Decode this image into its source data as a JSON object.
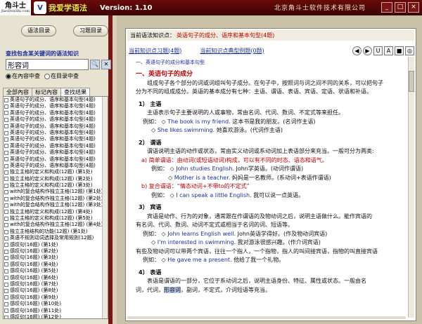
{
  "app": {
    "logo_text": "角斗士",
    "logo_sub": "JiaoDouShi.com",
    "brand_badge": "V",
    "brand_name": "我爱学语法",
    "version": "Version: 1.10",
    "company": "北京角斗士软件技术有限公司",
    "win_min": "_",
    "win_max": "□",
    "win_close": "×"
  },
  "left": {
    "btn_catalog": "语法目录",
    "btn_exercise": "习题目录",
    "search_title": "查找包含某关键词的语法知识",
    "search_value": "形容词",
    "search_btn1": "🔍",
    "search_btn2": "✕",
    "radio_current": "在內容中查",
    "radio_catalog": "在目录中查",
    "tabs": [
      "全部內容",
      "标记內容",
      "查找结果"
    ],
    "items": [
      "英语句子的成分、语序和基本句型(4题)",
      "英语句子的成分、语序和基本句型(4题)",
      "英语句子的成分、语序和基本句型(4题)",
      "英语句子的成分、语序和基本句型(4题)",
      "英语句子的成分、语序和基本句型(4题)",
      "英语句子的成分、语序和基本句型(4题)",
      "英语句子的成分、语序和基本句型(4题)",
      "英语句子的成分、语序和基本句型(4题)",
      "英语句子的成分、语序和基本句型(4题)",
      "英语句子的成分、语序和基本句型(4题)",
      "英语句子的成分、语序和基本句型(4题)",
      "独立主格的定义和构成(12题) (第1处)",
      "独立主格的定义和构成(12题) (第2处)",
      "独立主格的定义和构成(12题) (第3处)",
      "with的复合结构作独立主格(12题) (第1处)",
      "with的复合结构作独立主格(12题) (第2处)",
      "with的复合结构作独立主格(12题) (第3处)",
      "独立主格的定义和构成(12题) (第4处)",
      "独立主格的定义和构成(12题) (第5处)",
      "with的复合结构作独立主格(12题) (第4处)",
      "独立主格结构的功能(12题) (第1处)",
      "英语不规则动词选择及常用规则(12题)",
      "感叹句(16题) (第1处)",
      "感叹句(16题) (第2处)",
      "感叹句(16题) (第3处)",
      "感叹句(16题) (第4处)",
      "感叹句(16题) (第5处)",
      "感叹句(16题) (第6处)",
      "感叹句(16题) (第7处)",
      "感叹句(16题) (第8处)",
      "感叹句(16题) (第9处)",
      "感叹句(16题) (第10处)",
      "感叹句(16题) (第11处)",
      "感叹句(16题) (第12处)"
    ]
  },
  "main": {
    "current_label": "当前语法知识点：",
    "current_value": "英语句子的成分、语序和基本句型(4题)",
    "nav_link1": "当前知识点习题(4题)",
    "nav_link2": "当前知识点典型例题(0题)",
    "nav_buttons": [
      "◀",
      "▶",
      "U",
      "A",
      "■",
      "◎"
    ],
    "hl_bar": "一、英语句子的成分和基本句型",
    "content": {
      "h1": "一、英语句子的成分",
      "intro1": "组成句子各个部分的词或词组叫句子成分。在句子中，按照词与词之间不同的关系，可以把句子",
      "intro2": "分为不同的组成成分。英语的基本成分有七种：主语、谓语、表语、宾语、定语、状语和补语。",
      "s1_title": "1） 主语",
      "s1_p": "主语表示句子主要说明的人或事物，常由名词、代词、数词、不定式等来担任。",
      "s1_ex_label": "例如：",
      "s1_ex1_en": "The book is my friend.",
      "s1_ex1_cn": "这本书是我的朋友。(名词作主语)",
      "s1_ex2_en": "She likes swimming.",
      "s1_ex2_cn": "她喜欢游泳。(代词作主语)",
      "s2_title": "2） 谓语",
      "s2_p": "谓语说明主语的动作或状态，常由实义动词或系动词加上表语部分来充当。一般可分为两类:",
      "s2_a": "a) 简单谓语：由动词(或短语动词)构成，可以有不同的时态、语态和语气。",
      "s2_a_ex1_en": "John studies English.",
      "s2_a_ex1_cn": "John学英语。(动词作谓语)",
      "s2_a_ex2_en": "Mother is a teacher.",
      "s2_a_ex2_cn": "妈妈是一名教师。(系动词+表语作谓语)",
      "s2_b": "b) 复合谓语：“情态动词+不带to的不定式”",
      "s2_b_ex1_en": "I can speak a little English.",
      "s2_b_ex1_cn": "我可以说一点英语。",
      "s3_title": "3） 宾语",
      "s3_p1": "宾语是动作、行为的对象，通常跟在作谓语的及物动词之后，说明主语做什么。能作宾语的",
      "s3_p2": "有名词、代词、数词、动词不定式或相当于名词的词、短语等。",
      "s3_ex1_en": "John learns English well.",
      "s3_ex1_cn": "John英语学得好。(作及物动词宾语)",
      "s3_ex2_en": "I'm interested in swimming.",
      "s3_ex2_cn": "我对游泳很感兴趣。(作介词宾语)",
      "s3_p3": "有些及物动词可以带两个宾语，往往一个指人，一个指物，指人的叫间接宾语，指物的叫直接宾语",
      "s3_ex3_en": "He gave me a present.",
      "s3_ex3_cn": "他给了我一个礼物。",
      "s4_title": "4） 表语",
      "s4_p1": "表语是谓语的一部分，它位于系动词之后，说明主语身份、特征、属性或状态。一般由名",
      "s4_p2_a": "词，代词，",
      "s4_p2_sel": "形容词",
      "s4_p2_b": "，副词，不定式，介词短语等充当。"
    }
  },
  "colors": {
    "accent_red": "#c00000",
    "link_blue": "#1a2fa0",
    "frame_dark_red": "#7a1515"
  }
}
